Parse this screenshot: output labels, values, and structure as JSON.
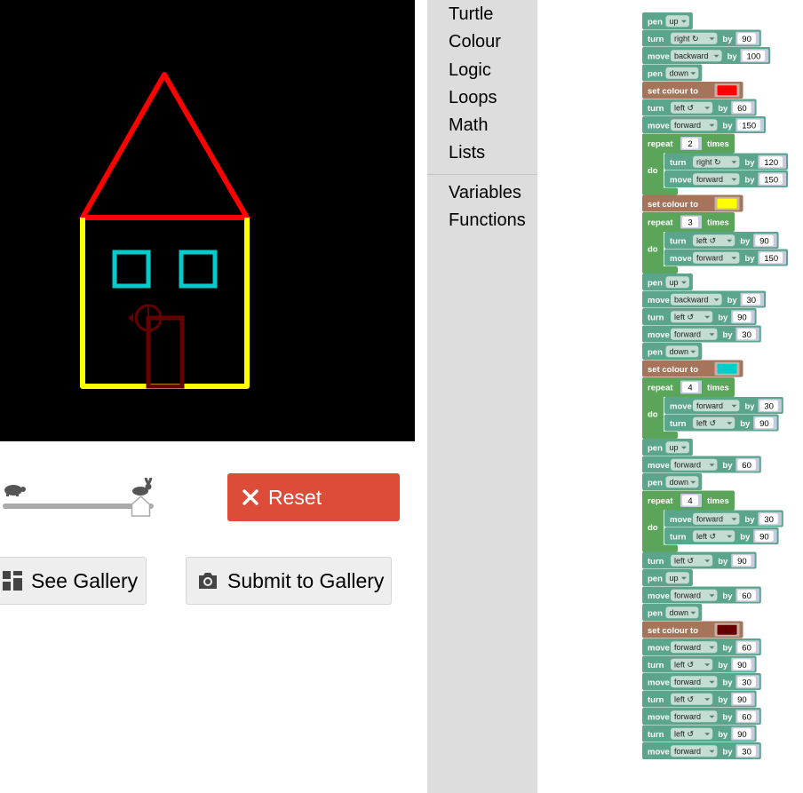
{
  "drawing": {
    "background": "#000000",
    "colors": {
      "roof": "#ff0000",
      "walls": "#ffff00",
      "windows": "#00cccc",
      "door": "#660000"
    }
  },
  "controls": {
    "slow_icon": "turtle-icon",
    "fast_icon": "rabbit-icon",
    "speed_level": 0.95,
    "reset_label": "Reset",
    "see_gallery_label": "See Gallery",
    "submit_gallery_label": "Submit to Gallery",
    "reset_color": "#dd4b39"
  },
  "toolbox": {
    "categories": [
      "Turtle",
      "Colour",
      "Logic",
      "Loops",
      "Math",
      "Lists"
    ],
    "categories2": [
      "Variables",
      "Functions"
    ]
  },
  "block_colors": {
    "turtle": "#5ba58c",
    "colour": "#a5745b",
    "loop": "#5ba55b",
    "field": "#c3ddd3",
    "number": "#ffffff"
  },
  "program": [
    {
      "type": "pen",
      "label": "pen",
      "value": "up"
    },
    {
      "type": "turn",
      "label": "turn",
      "dir": "right ↻",
      "by": "by",
      "value": "90"
    },
    {
      "type": "move",
      "label": "move",
      "dir": "backward",
      "by": "by",
      "value": "100"
    },
    {
      "type": "pen",
      "label": "pen",
      "value": "down"
    },
    {
      "type": "colour",
      "label": "set colour to",
      "color": "#ff0000"
    },
    {
      "type": "turn",
      "label": "turn",
      "dir": "left ↺",
      "by": "by",
      "value": "60"
    },
    {
      "type": "move",
      "label": "move",
      "dir": "forward",
      "by": "by",
      "value": "150"
    },
    {
      "type": "repeat",
      "label": "repeat",
      "count": "2",
      "times": "times",
      "do": "do",
      "body": [
        {
          "type": "turn",
          "label": "turn",
          "dir": "right ↻",
          "by": "by",
          "value": "120"
        },
        {
          "type": "move",
          "label": "move",
          "dir": "forward",
          "by": "by",
          "value": "150"
        }
      ]
    },
    {
      "type": "colour",
      "label": "set colour to",
      "color": "#ffff00"
    },
    {
      "type": "repeat",
      "label": "repeat",
      "count": "3",
      "times": "times",
      "do": "do",
      "body": [
        {
          "type": "turn",
          "label": "turn",
          "dir": "left ↺",
          "by": "by",
          "value": "90"
        },
        {
          "type": "move",
          "label": "move",
          "dir": "forward",
          "by": "by",
          "value": "150"
        }
      ]
    },
    {
      "type": "pen",
      "label": "pen",
      "value": "up"
    },
    {
      "type": "move",
      "label": "move",
      "dir": "backward",
      "by": "by",
      "value": "30"
    },
    {
      "type": "turn",
      "label": "turn",
      "dir": "left ↺",
      "by": "by",
      "value": "90"
    },
    {
      "type": "move",
      "label": "move",
      "dir": "forward",
      "by": "by",
      "value": "30"
    },
    {
      "type": "pen",
      "label": "pen",
      "value": "down"
    },
    {
      "type": "colour",
      "label": "set colour to",
      "color": "#00cccc"
    },
    {
      "type": "repeat",
      "label": "repeat",
      "count": "4",
      "times": "times",
      "do": "do",
      "body": [
        {
          "type": "move",
          "label": "move",
          "dir": "forward",
          "by": "by",
          "value": "30"
        },
        {
          "type": "turn",
          "label": "turn",
          "dir": "left ↺",
          "by": "by",
          "value": "90"
        }
      ]
    },
    {
      "type": "pen",
      "label": "pen",
      "value": "up"
    },
    {
      "type": "move",
      "label": "move",
      "dir": "forward",
      "by": "by",
      "value": "60"
    },
    {
      "type": "pen",
      "label": "pen",
      "value": "down"
    },
    {
      "type": "repeat",
      "label": "repeat",
      "count": "4",
      "times": "times",
      "do": "do",
      "body": [
        {
          "type": "move",
          "label": "move",
          "dir": "forward",
          "by": "by",
          "value": "30"
        },
        {
          "type": "turn",
          "label": "turn",
          "dir": "left ↺",
          "by": "by",
          "value": "90"
        }
      ]
    },
    {
      "type": "turn",
      "label": "turn",
      "dir": "left ↺",
      "by": "by",
      "value": "90"
    },
    {
      "type": "pen",
      "label": "pen",
      "value": "up"
    },
    {
      "type": "move",
      "label": "move",
      "dir": "forward",
      "by": "by",
      "value": "60"
    },
    {
      "type": "pen",
      "label": "pen",
      "value": "down"
    },
    {
      "type": "colour",
      "label": "set colour to",
      "color": "#660000"
    },
    {
      "type": "move",
      "label": "move",
      "dir": "forward",
      "by": "by",
      "value": "60"
    },
    {
      "type": "turn",
      "label": "turn",
      "dir": "left ↺",
      "by": "by",
      "value": "90"
    },
    {
      "type": "move",
      "label": "move",
      "dir": "forward",
      "by": "by",
      "value": "30"
    },
    {
      "type": "turn",
      "label": "turn",
      "dir": "left ↺",
      "by": "by",
      "value": "90"
    },
    {
      "type": "move",
      "label": "move",
      "dir": "forward",
      "by": "by",
      "value": "60"
    },
    {
      "type": "turn",
      "label": "turn",
      "dir": "left ↺",
      "by": "by",
      "value": "90"
    },
    {
      "type": "move",
      "label": "move",
      "dir": "forward",
      "by": "by",
      "value": "30"
    }
  ]
}
